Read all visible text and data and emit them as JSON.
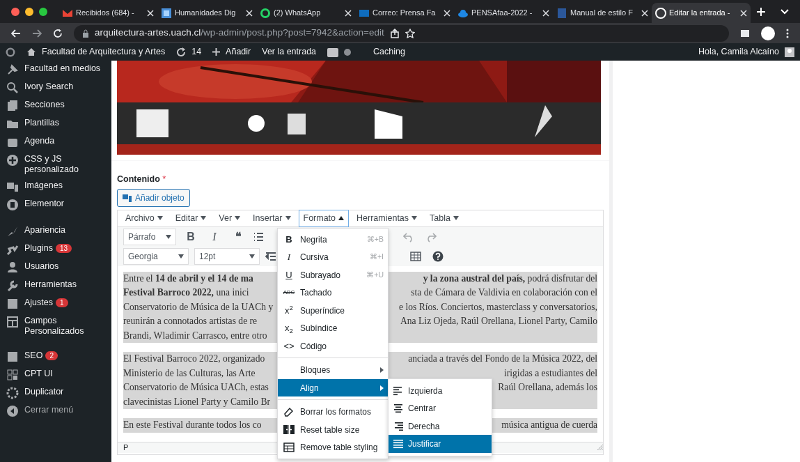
{
  "browser": {
    "tabs": [
      {
        "title": "Recibidos (684) -",
        "selected": false
      },
      {
        "title": "Humanidades Dig",
        "selected": false
      },
      {
        "title": "(2) WhatsApp",
        "selected": false
      },
      {
        "title": "Correo: Prensa Fa",
        "selected": false
      },
      {
        "title": "PENSAfaa-2022 -",
        "selected": false
      },
      {
        "title": "Manual de estilo F",
        "selected": false
      },
      {
        "title": "Editar la entrada -",
        "selected": true
      }
    ],
    "url_host": "arquitectura-artes.uach.cl",
    "url_path": "/wp-admin/post.php?post=7942&action=edit"
  },
  "admin_bar": {
    "site": "Facultad de Arquitectura y Artes",
    "updates": "14",
    "add": "Añadir",
    "view": "Ver la entrada",
    "caching": "Caching",
    "greeting": "Hola, Camila Alcaíno"
  },
  "sidebar": {
    "groups": [
      [
        {
          "label": "Facultad en medios"
        },
        {
          "label": "Ivory Search"
        },
        {
          "label": "Secciones"
        },
        {
          "label": "Plantillas"
        },
        {
          "label": "Agenda"
        },
        {
          "label": "CSS y JS personalizado"
        },
        {
          "label": "Imágenes"
        },
        {
          "label": "Elementor"
        }
      ],
      [
        {
          "label": "Apariencia"
        },
        {
          "label": "Plugins",
          "badge": "13"
        },
        {
          "label": "Usuarios"
        },
        {
          "label": "Herramientas"
        },
        {
          "label": "Ajustes",
          "badge": "1"
        },
        {
          "label": "Campos Personalizados"
        }
      ],
      [
        {
          "label": "SEO",
          "badge": "2"
        },
        {
          "label": "CPT UI"
        },
        {
          "label": "Duplicator"
        },
        {
          "label": "Cerrar menú",
          "kind": "collapse"
        }
      ]
    ]
  },
  "editor": {
    "label": "Contenido",
    "required_mark": "*",
    "add_media": "Añadir objeto",
    "menubar": [
      {
        "label": "Archivo",
        "open": false
      },
      {
        "label": "Editar",
        "open": false
      },
      {
        "label": "Ver",
        "open": false
      },
      {
        "label": "Insertar",
        "open": false
      },
      {
        "label": "Formato",
        "open": true
      },
      {
        "label": "Herramientas",
        "open": false
      },
      {
        "label": "Tabla",
        "open": false
      }
    ],
    "toolbar_1": {
      "left": [
        {
          "kind": "select",
          "value": "Párrafo"
        },
        {
          "kind": "bold",
          "text": "B"
        },
        {
          "kind": "italic",
          "text": "I"
        },
        {
          "kind": "quote",
          "text": "❝"
        },
        {
          "kind": "list"
        }
      ],
      "right": [
        {
          "kind": "undo"
        },
        {
          "kind": "redo"
        }
      ]
    },
    "toolbar_2": {
      "left": [
        {
          "kind": "select",
          "value": "Georgia"
        },
        {
          "kind": "select",
          "value": "12pt"
        },
        {
          "kind": "indent"
        }
      ],
      "right": [
        {
          "kind": "table"
        },
        {
          "kind": "help"
        }
      ]
    },
    "paragraphs": [
      {
        "lines": [
          {
            "left": "Entre el **14 de abril y el 14 de ma**",
            "right": "**y la zona austral del país,** podrá disfrutar del"
          },
          {
            "left": "**Festival Barroco 2022,** una inici",
            "right": "sta de Cámara de Valdivia en colaboración con el"
          },
          {
            "left": "Conservatorio de Música de la UACh y",
            "right": "e los Ríos. Conciertos, masterclass y conversatorios,"
          },
          {
            "left": "reunirán a connotados artistas de re",
            "right": "Ana Liz Ojeda, Raúl Orellana, Lionel Party, Camilo"
          },
          {
            "left": "Brandi, Wladimir Carrasco, entre otro"
          }
        ]
      },
      {
        "lines": [
          {
            "left": "El Festival Barroco 2022, organizado",
            "right": "anciada a través del Fondo de la Música 2022, del"
          },
          {
            "left": "Ministerio de las Culturas, las Arte",
            "right": "irigidas a estudiantes del"
          },
          {
            "left": "Conservatorio de Música UACh, estas",
            "right": "Raúl Orellana, además los"
          },
          {
            "left": "clavecinistas Lionel Party y Camilo Br"
          }
        ]
      },
      {
        "lines": [
          {
            "left": "En este Festival durante todos los co",
            "right": "música antigua de cuerda"
          }
        ]
      }
    ],
    "status_path": "P",
    "format_menu": {
      "groups": [
        [
          {
            "kind": "glyph",
            "glyph": "B",
            "label": "Negrita",
            "shortcut": "⌘+B",
            "submenu": false,
            "selected": false
          },
          {
            "kind": "glyph",
            "glyph": "I",
            "label": "Cursiva",
            "shortcut": "⌘+I",
            "submenu": false,
            "selected": false
          },
          {
            "kind": "glyph",
            "glyph": "U",
            "label": "Subrayado",
            "shortcut": "⌘+U",
            "submenu": false,
            "selected": false
          },
          {
            "kind": "glyph",
            "glyph": "ABC",
            "label": "Tachado",
            "submenu": false,
            "selected": false
          },
          {
            "kind": "glyph",
            "glyph": "x$^{2}$",
            "label": "Superíndice",
            "submenu": false,
            "selected": false
          },
          {
            "kind": "glyph",
            "glyph": "x$_{2}$",
            "label": "Subíndice",
            "submenu": false,
            "selected": false
          },
          {
            "kind": "glyph",
            "glyph": "<>",
            "label": "Código",
            "submenu": false,
            "selected": false
          }
        ],
        [
          {
            "kind": "plain",
            "label": "Bloques",
            "submenu": true,
            "selected": false
          },
          {
            "kind": "plain",
            "label": "Align",
            "submenu": true,
            "selected": true
          }
        ],
        [
          {
            "kind": "eraser",
            "label": "Borrar los formatos",
            "submenu": false,
            "selected": false
          },
          {
            "kind": "resize",
            "label": "Reset table size",
            "submenu": false,
            "selected": false
          },
          {
            "kind": "table",
            "label": "Remove table styling",
            "submenu": false,
            "selected": false
          }
        ]
      ]
    },
    "align_menu": {
      "items": [
        {
          "label": "Izquierda",
          "selected": false
        },
        {
          "label": "Centrar",
          "selected": false
        },
        {
          "label": "Derecha",
          "selected": false
        },
        {
          "label": "Justificar",
          "selected": true
        }
      ]
    }
  }
}
